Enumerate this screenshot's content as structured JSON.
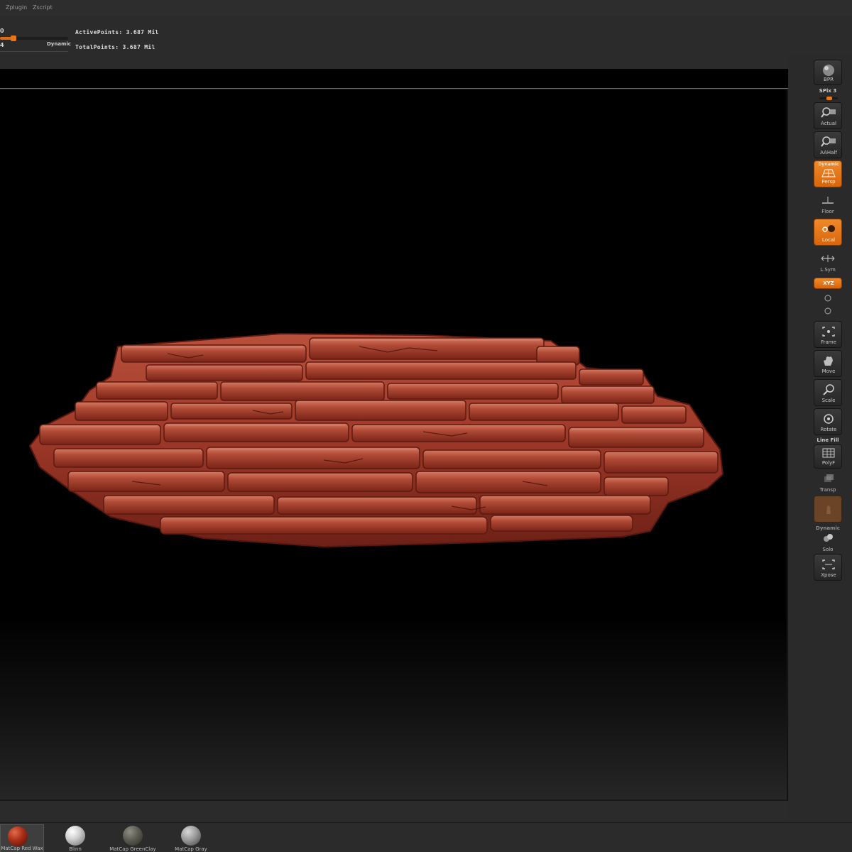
{
  "menu": {
    "items": [
      "Zplugin",
      "Zscript"
    ]
  },
  "topbar": {
    "slider1_value": "0",
    "slider2_value": "4",
    "dynamic_label": "Dynamic",
    "active_points": "ActivePoints: 3.687  Mil",
    "total_points": "TotalPoints: 3.687  Mil"
  },
  "colors": {
    "accent": "#e8781c",
    "model": "#9c3526",
    "background": "#000000"
  },
  "shelf": {
    "bpr_label": "BPR",
    "spix_label": "SPix 3",
    "actual": "Actual",
    "aahalf": "AAHalf",
    "persp_tag": "Dynamic",
    "persp": "Persp",
    "floor": "Floor",
    "local": "Local",
    "lsym": "L.Sym",
    "xyz": "XYZ",
    "frame": "Frame",
    "move": "Move",
    "scale": "Scale",
    "rotate": "Rotate",
    "linefill": "Line Fill",
    "polyf": "PolyF",
    "transp": "Transp",
    "solo_tag": "Dynamic",
    "solo": "Solo",
    "xpose": "Xpose"
  },
  "materials": [
    {
      "label": "MatCap  Red  Wax",
      "color": "red",
      "selected": true
    },
    {
      "label": "Blinn",
      "color": "white",
      "selected": false
    },
    {
      "label": "MatCap  GreenClay",
      "color": "greenclay",
      "selected": false
    },
    {
      "label": "MatCap  Gray",
      "color": "gray",
      "selected": false
    }
  ]
}
